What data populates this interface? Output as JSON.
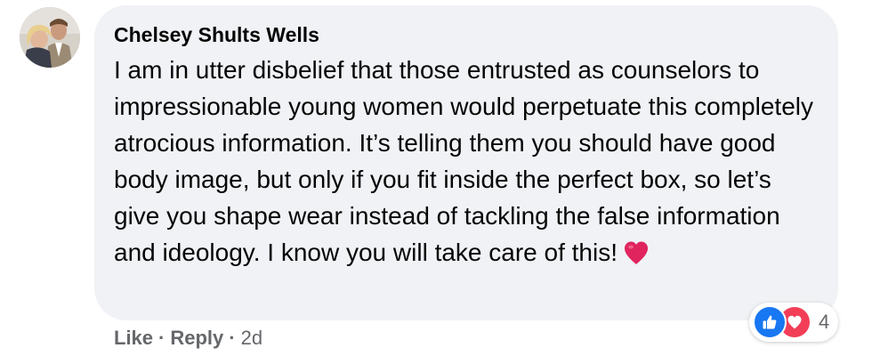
{
  "comment": {
    "author": "Chelsey Shults Wells",
    "text": "I am in utter disbelief that those entrusted as counselors to impressionable young women would perpetuate this completely atrocious information. It’s telling them you should have good body image, but only if you fit inside the perfect box, so let’s give you shape wear instead of tackling the false information and ideology. I know you will take care of this!",
    "emoji": "red-heart-emoji"
  },
  "reactions": {
    "icons": [
      "like-icon",
      "love-icon"
    ],
    "count": "4"
  },
  "actions": {
    "like_label": "Like",
    "reply_label": "Reply",
    "separator": "·",
    "timestamp": "2d"
  },
  "colors": {
    "bubble_bg": "#f0f2f5",
    "text": "#050505",
    "muted": "#65676b",
    "like_blue": "#1877f2",
    "love_red": "#f33e58",
    "heart_emoji": "#e0245e"
  }
}
